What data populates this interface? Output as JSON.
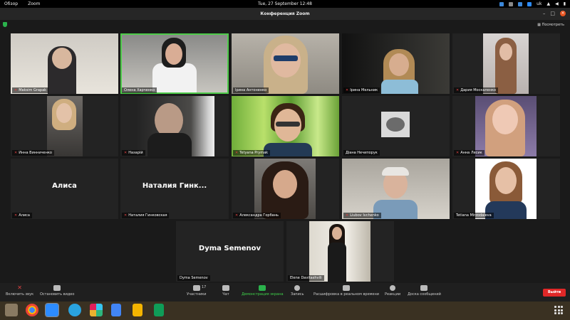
{
  "topbar": {
    "activities": "Обзор",
    "app_menu": "Zoom",
    "clock": "Tue, 27 September  12:48",
    "lang": "uk"
  },
  "window": {
    "title": "Конференция Zoom",
    "view_button": "Посмотреть"
  },
  "participants": [
    {
      "name": "Maksim Grapak",
      "muted": true,
      "avatar_text": ""
    },
    {
      "name": "Олена Харченко",
      "muted": false,
      "active": true,
      "avatar_text": ""
    },
    {
      "name": "Ірина Антоненко",
      "muted": false,
      "avatar_text": ""
    },
    {
      "name": "Ірина Мельник",
      "muted": true,
      "avatar_text": ""
    },
    {
      "name": "Дария Москаленко",
      "muted": true,
      "avatar_text": ""
    },
    {
      "name": "Инна Винниченко",
      "muted": true,
      "avatar_text": ""
    },
    {
      "name": "Назарій",
      "muted": true,
      "avatar_text": ""
    },
    {
      "name": "Tetyana Prymak",
      "muted": true,
      "avatar_text": ""
    },
    {
      "name": "Діана Нечипорук",
      "muted": false,
      "avatar_text": ""
    },
    {
      "name": "Анна Лесик",
      "muted": true,
      "avatar_text": ""
    },
    {
      "name": "Алиса",
      "muted": true,
      "avatar_text": "Алиса"
    },
    {
      "name": "Наталия Гинковская",
      "muted": true,
      "avatar_text": "Наталия Гинк..."
    },
    {
      "name": "Александра Горбань",
      "muted": true,
      "avatar_text": ""
    },
    {
      "name": "Liubov Ivchenko",
      "muted": true,
      "avatar_text": ""
    },
    {
      "name": "Tetiana Mirzodaieva",
      "muted": false,
      "avatar_text": ""
    },
    {
      "name": "Dyma Semenov",
      "muted": false,
      "avatar_text": "Dyma Semenov"
    },
    {
      "name": "Elene Davitashvili",
      "muted": false,
      "avatar_text": ""
    }
  ],
  "toolbar": {
    "unmute": "Включить звук",
    "start_video": "Остановить видео",
    "participants": "Участники",
    "participants_count": "17",
    "chat": "Чат",
    "share_screen": "Демонстрация экрана",
    "record": "Запись",
    "live_transcript": "Расшифровка в реальном времени",
    "reactions": "Реакции",
    "whiteboard": "Доска сообщений",
    "end": "Выйти"
  },
  "colors": {
    "active_speaker": "#4ecb4a",
    "share_green": "#2bb24c",
    "end_red": "#e02828",
    "muted_red": "#e04141"
  },
  "taskbar": {
    "apps": [
      "files-icon",
      "chrome-icon",
      "zoom-icon",
      "telegram-icon",
      "slack-icon",
      "docs-icon",
      "slides-icon",
      "sheets-icon"
    ]
  }
}
